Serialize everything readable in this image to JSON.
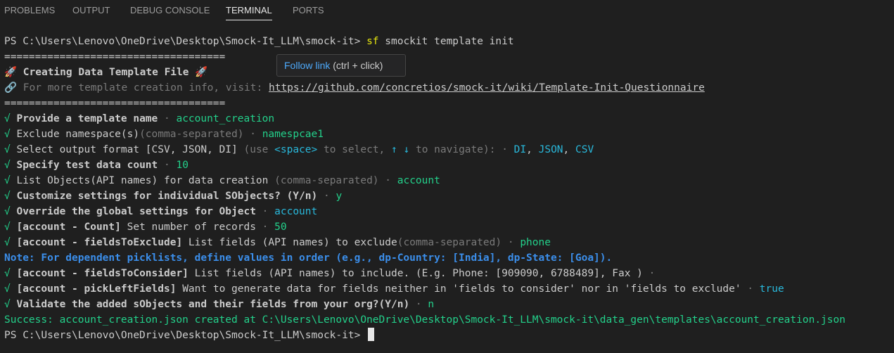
{
  "tabs": [
    "PROBLEMS",
    "OUTPUT",
    "DEBUG CONSOLE",
    "TERMINAL",
    "PORTS"
  ],
  "tooltip": {
    "link_text": "Follow link",
    "hint": "(ctrl + click)"
  },
  "terminal": {
    "prompt": "PS C:\\Users\\Lenovo\\OneDrive\\Desktop\\Smock-It_LLM\\smock-it>",
    "cmd_sf": "sf",
    "cmd_rest": "smockit template init",
    "separator": "====================================",
    "title": "🚀 Creating Data Template File 🚀",
    "info_prefix": "🔗 For more template creation info, visit: ",
    "info_url": "https://github.com/concretios/smock-it/wiki/Template-Init-Questionnaire",
    "check": "√",
    "q1": {
      "label": "Provide a template name",
      "answer": "account_creation"
    },
    "q2": {
      "label": "Exclude namespace(s)",
      "hint": "(comma-separated)",
      "answer": "namespcae1"
    },
    "q3": {
      "label": "Select output format [CSV, JSON, DI]",
      "h1": "(use",
      "space": "<space>",
      "h2": "to select,",
      "arrows": "↑ ↓",
      "h3": "to navigate):",
      "a1": "DI",
      "a2": "JSON",
      "a3": "CSV"
    },
    "q4": {
      "label": "Specify test data count",
      "answer": "10"
    },
    "q5": {
      "label": "List Objects(API names) for data creation",
      "hint": "(comma-separated)",
      "answer": "account"
    },
    "q6": {
      "label": "Customize settings for individual SObjects? (Y/n)",
      "answer": "y"
    },
    "q7": {
      "label": "Override the global settings for Object",
      "answer": "account"
    },
    "q8": {
      "tag": "[account - Count]",
      "label": "Set number of records",
      "answer": "50"
    },
    "q9": {
      "tag": "[account - fieldsToExclude]",
      "label": "List fields (API names) to exclude",
      "hint": "(comma-separated)",
      "answer": "phone"
    },
    "note": "Note: For dependent picklists, define values in order (e.g., dp-Country: [India], dp-State: [Goa]).",
    "q10": {
      "tag": "[account - fieldsToConsider]",
      "label": "List fields (API names) to include. (E.g. Phone: [909090, 6788489], Fax )"
    },
    "q11": {
      "tag": "[account - pickLeftFields]",
      "label": "Want to generate data for fields neither in 'fields to consider' nor in 'fields to exclude'",
      "answer": "true"
    },
    "q12": {
      "label": "Validate the added sObjects and their fields from your org?(Y/n)",
      "answer": "n"
    },
    "success": "Success: account_creation.json created at C:\\Users\\Lenovo\\OneDrive\\Desktop\\Smock-It_LLM\\smock-it\\data_gen\\templates\\account_creation.json",
    "dot": "·"
  }
}
